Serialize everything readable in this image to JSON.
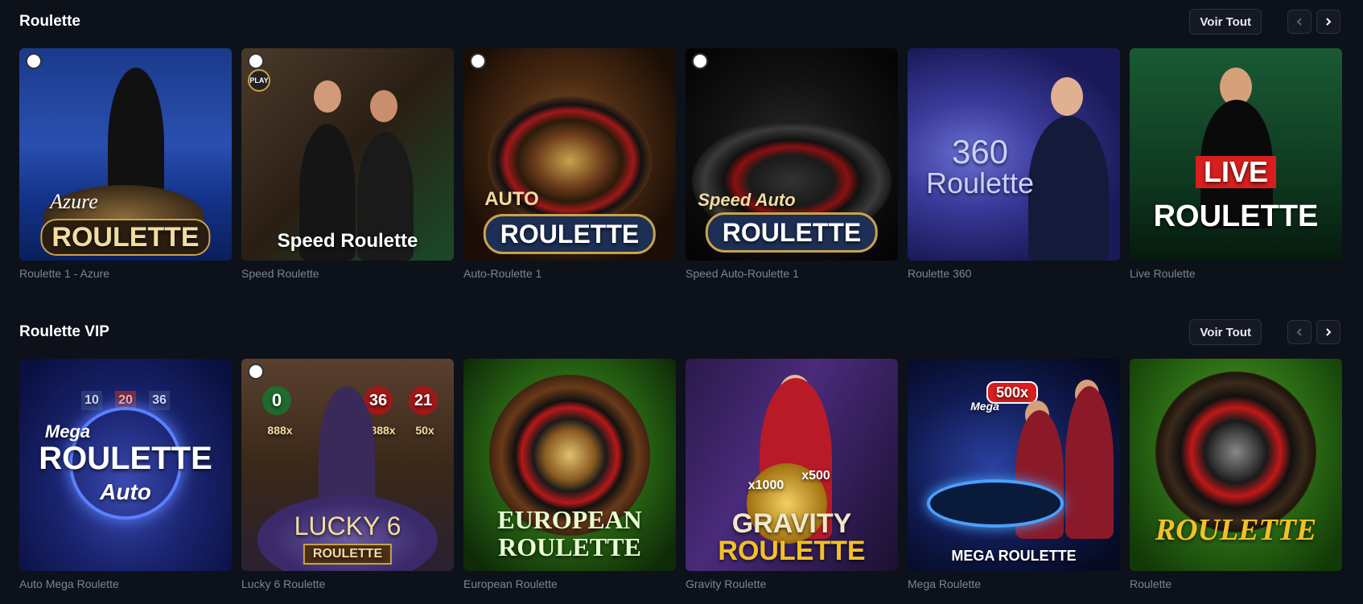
{
  "sections": [
    {
      "title": "Roulette",
      "voir_tout": "Voir Tout",
      "games": [
        {
          "name": "Roulette 1 - Azure",
          "logo_top": "Azure",
          "logo": "ROULETTE"
        },
        {
          "name": "Speed Roulette",
          "logo_top": "",
          "logo": "Speed Roulette",
          "badge": "PLAY"
        },
        {
          "name": "Auto-Roulette 1",
          "logo_top": "AUTO",
          "logo": "ROULETTE"
        },
        {
          "name": "Speed Auto-Roulette 1",
          "logo_top": "Speed Auto",
          "logo": "ROULETTE"
        },
        {
          "name": "Roulette 360",
          "logo_top": "360",
          "logo": "Roulette"
        },
        {
          "name": "Live Roulette",
          "logo_top": "LIVE",
          "logo": "ROULETTE"
        }
      ]
    },
    {
      "title": "Roulette VIP",
      "voir_tout": "Voir Tout",
      "games": [
        {
          "name": "Auto Mega Roulette",
          "logo_top": "Mega",
          "logo": "ROULETTE",
          "logo_bottom": "Auto",
          "numbers": [
            "10",
            "20",
            "36"
          ]
        },
        {
          "name": "Lucky 6 Roulette",
          "logo_top": "LUCKY 6",
          "logo": "ROULETTE",
          "numbers": [
            "0",
            "36",
            "21"
          ],
          "multipliers": [
            "888x",
            "888x",
            "50x"
          ]
        },
        {
          "name": "European Roulette",
          "logo_top": "EUROPEAN",
          "logo": "ROULETTE"
        },
        {
          "name": "Gravity Roulette",
          "logo_top": "GRAVITY",
          "logo": "ROULETTE",
          "multipliers": [
            "x1000",
            "x500"
          ]
        },
        {
          "name": "Mega Roulette",
          "logo_top": "Mega",
          "logo": "MEGA ROULETTE",
          "multipliers": [
            "500x"
          ]
        },
        {
          "name": "Roulette",
          "logo_top": "",
          "logo": "ROULETTE"
        }
      ]
    }
  ],
  "icons": {
    "prev": "chevron-left-icon",
    "next": "chevron-right-icon"
  }
}
